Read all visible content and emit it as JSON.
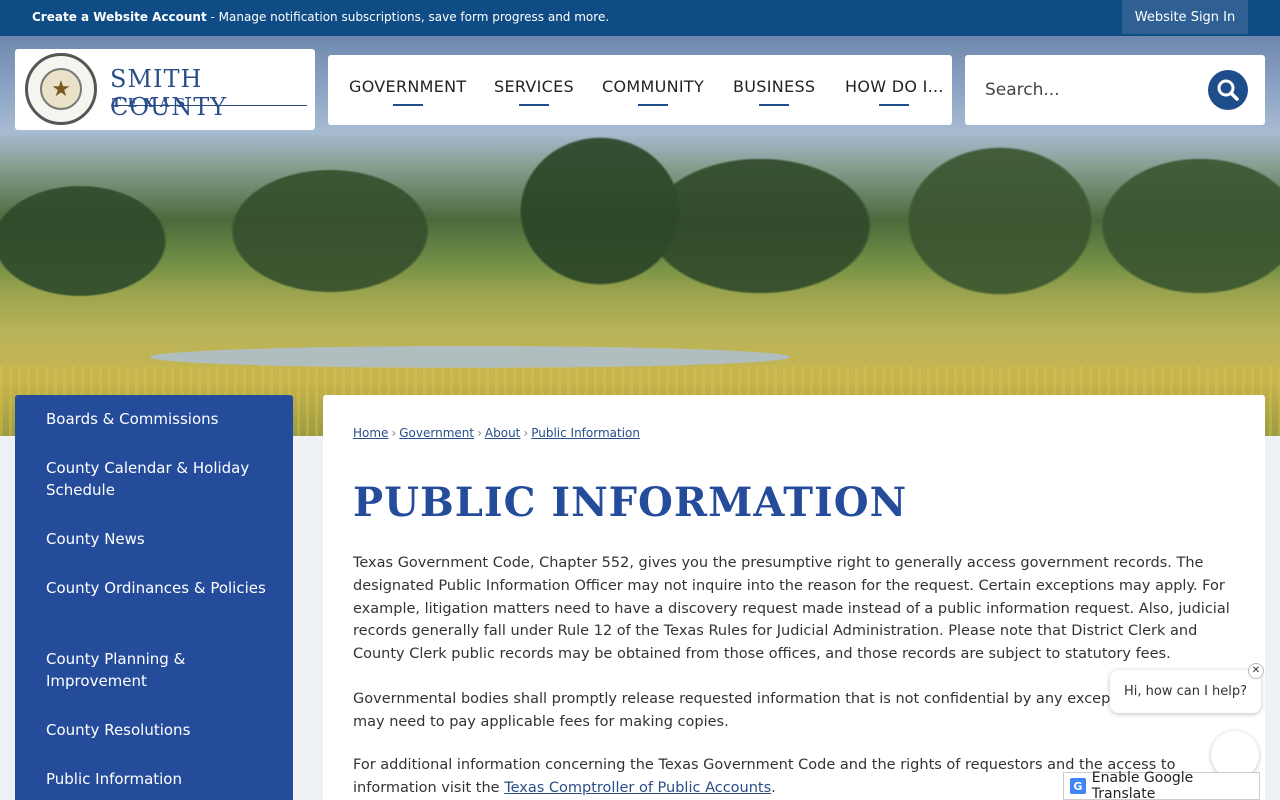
{
  "topbar": {
    "create_account": "Create a Website Account",
    "message": " - Manage notification subscriptions, save form progress and more.",
    "sign_in": "Website Sign In"
  },
  "logo": {
    "name": "SMITH COUNTY",
    "state": "TEXAS",
    "seal_icon": "county-seal-star"
  },
  "nav": {
    "items": [
      "GOVERNMENT",
      "SERVICES",
      "COMMUNITY",
      "BUSINESS",
      "HOW DO I..."
    ]
  },
  "search": {
    "placeholder": "Search...",
    "icon": "search-icon"
  },
  "sidebar": {
    "items": [
      "Boards & Commissions",
      "County Calendar & Holiday Schedule",
      "County News",
      "County Ordinances & Policies",
      "County Planning & Improvement",
      "County Resolutions",
      "Public Information"
    ]
  },
  "breadcrumb": [
    "Home",
    "Government",
    "About",
    "Public Information"
  ],
  "page": {
    "title": "PUBLIC INFORMATION",
    "p1": "Texas Government Code, Chapter 552, gives you the presumptive right to generally access government records. The designated Public Information Officer may not inquire into the reason for the request. Certain exceptions may apply. For example, litigation matters need to have a discovery request made instead of a public information request. Also, judicial records generally fall under Rule 12 of the Texas Rules for Judicial Administration. Please note that District Clerk and County Clerk public records may be obtained from those offices, and those records are subject to statutory fees.",
    "p2": "Governmental bodies shall promptly release requested information that is not confidential by any exception. H requester may need to pay applicable fees for making copies.",
    "p3_text": "For additional information concerning the Texas Government Code and the rights of requestors and the access to information visit the ",
    "p3_link": "Texas Comptroller of Public Accounts",
    "p3_end": "."
  },
  "chat": {
    "greeting": "Hi, how can I help?",
    "close": "✕"
  },
  "translate": {
    "label": "Enable Google Translate",
    "icon_letter": "G"
  },
  "colors": {
    "topbar": "#0f4c86",
    "primary": "#244c9a",
    "link": "#2a4e8a"
  }
}
